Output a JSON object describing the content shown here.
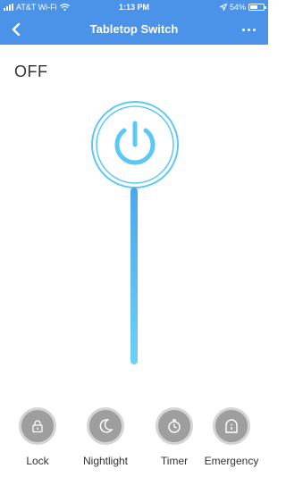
{
  "status_bar": {
    "carrier": "AT&T Wi-Fi",
    "time": "1:13 PM",
    "battery_percent": "54%",
    "battery_level": 0.54
  },
  "nav": {
    "title": "Tabletop Switch",
    "back_icon": "chevron-left-icon",
    "more_icon": "more-horizontal-icon"
  },
  "device": {
    "state": "OFF",
    "accent_color": "#5bc8f5"
  },
  "actions": [
    {
      "label": "Lock",
      "icon": "lock-icon"
    },
    {
      "label": "Nightlight",
      "icon": "moon-icon"
    },
    {
      "label": "Timer",
      "icon": "timer-icon"
    },
    {
      "label": "Emergency",
      "icon": "emergency-icon"
    }
  ],
  "colors": {
    "header": "#4a93e8",
    "power_accent": "#5bc8f5",
    "action_circle": "#9e9e9e"
  }
}
